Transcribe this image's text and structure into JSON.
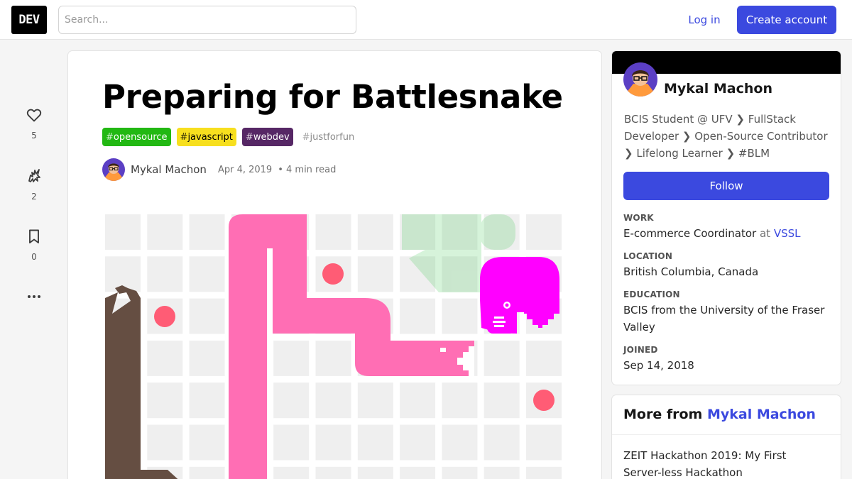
{
  "header": {
    "logo_text": "DEV",
    "search_placeholder": "Search...",
    "login_label": "Log in",
    "create_account_label": "Create account"
  },
  "reactions": [
    {
      "icon": "heart-icon",
      "count": "5"
    },
    {
      "icon": "unicorn-icon",
      "count": "2"
    },
    {
      "icon": "bookmark-icon",
      "count": "0"
    },
    {
      "icon": "more-horizontal-icon"
    }
  ],
  "article": {
    "title": "Preparing for Battlesnake",
    "tags": [
      {
        "hash": "#",
        "name": "opensource",
        "bg": "#22b813",
        "fg": "#ffffff"
      },
      {
        "hash": "#",
        "name": "javascript",
        "bg": "#f7df1e",
        "fg": "#000000"
      },
      {
        "hash": "#",
        "name": "webdev",
        "bg": "#562765",
        "fg": "#ffffff"
      },
      {
        "hash": "#",
        "name": "justforfun",
        "bg": "transparent",
        "fg": "#8a8a8a"
      }
    ],
    "author": "Mykal Machon",
    "date": "Apr 4, 2019",
    "read_time": "• 4 min read"
  },
  "profile": {
    "name": "Mykal Machon",
    "bio": "BCIS Student @ UFV ❯ FullStack Developer ❯ Open-Source Contributor ❯ Lifelong Learner ❯ #BLM",
    "follow_label": "Follow",
    "work_label": "Work",
    "work_role": "E-commerce Coordinator",
    "work_at": "at",
    "work_company": "VSSL",
    "location_label": "Location",
    "location": "British Columbia, Canada",
    "education_label": "Education",
    "education": "BCIS from the University of the Fraser Valley",
    "joined_label": "Joined",
    "joined": "Sep 14, 2018"
  },
  "more_from": {
    "prefix": "More from",
    "author": "Mykal Machon",
    "items": [
      "ZEIT Hackathon 2019: My First Server-less Hackathon"
    ]
  },
  "colors": {
    "accent": "#3b49df",
    "snake_pink": "#ff6eb4",
    "snake_magenta": "#ff00ff",
    "snake_brown": "#654e42",
    "food": "#ff5c75",
    "board_cell": "#efefef"
  }
}
